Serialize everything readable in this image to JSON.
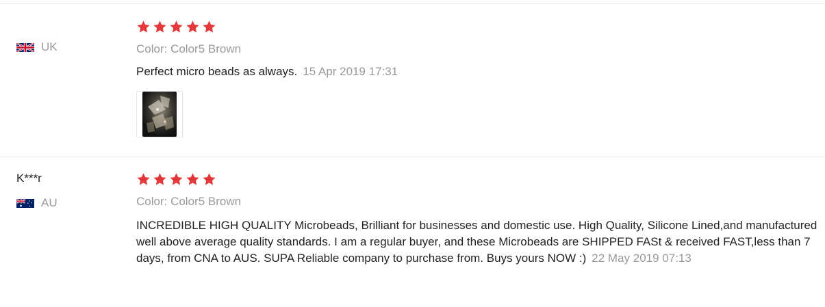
{
  "reviews": [
    {
      "buyer_name": "",
      "country_code": "UK",
      "flag_icon": "uk-flag-icon",
      "star_icon": "star-icon",
      "star_color": "#e4393c",
      "rating": 5,
      "sku_text": "Color: Color5 Brown",
      "feedback_text": "Perfect micro beads as always.",
      "date_text": "15 Apr 2019 17:31",
      "photos": [
        "beads-photo"
      ]
    },
    {
      "buyer_name": "K***r",
      "country_code": "AU",
      "flag_icon": "au-flag-icon",
      "star_icon": "star-icon",
      "star_color": "#e4393c",
      "rating": 5,
      "sku_text": "Color: Color5 Brown",
      "feedback_text": "INCREDIBLE HIGH QUALITY Microbeads, Brilliant for businesses and domestic use. High Quality, Silicone Lined,and manufactured well above average quality standards. I am a regular buyer, and these Microbeads are SHIPPED FASt & received FAST,less than 7 days, from CNA to AUS. SUPA Reliable company to purchase from. Buys yours NOW :)",
      "date_text": "22 May 2019 07:13",
      "photos": []
    }
  ]
}
